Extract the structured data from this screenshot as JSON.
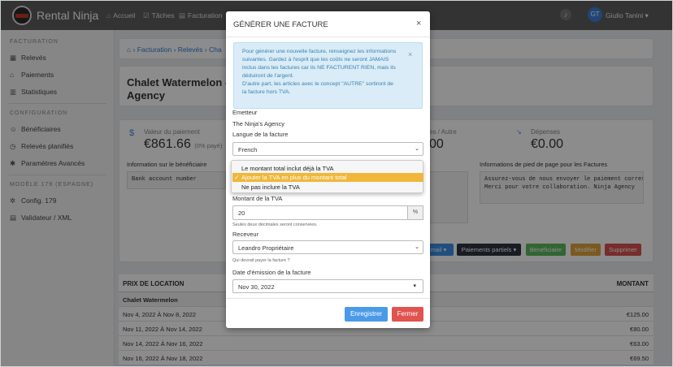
{
  "app": {
    "brand": "Rental Ninja"
  },
  "topnav": {
    "items": [
      {
        "label": "Accueil",
        "icon": "home-icon"
      },
      {
        "label": "Tâches",
        "icon": "checkbox-icon"
      },
      {
        "label": "Facturation",
        "icon": "invoice-icon"
      }
    ],
    "user": {
      "initials": "GT",
      "name": "Giulio Tanini"
    }
  },
  "sidebar": {
    "sections": [
      {
        "title": "FACTURATION",
        "items": [
          {
            "label": "Relevés",
            "icon": "statement-icon"
          },
          {
            "label": "Paiements",
            "icon": "bank-icon"
          },
          {
            "label": "Statistiques",
            "icon": "chart-icon"
          }
        ]
      },
      {
        "title": "CONFIGURATION",
        "items": [
          {
            "label": "Bénéficiaires",
            "icon": "user-circle-icon"
          },
          {
            "label": "Relevés planifiés",
            "icon": "calendar-check-icon"
          },
          {
            "label": "Paramètres Avancés",
            "icon": "gears-icon"
          }
        ]
      },
      {
        "title": "MODÈLE 179 (ESPAGNE)",
        "items": [
          {
            "label": "Config. 179",
            "icon": "cog-icon"
          },
          {
            "label": "Validateur / XML",
            "icon": "document-icon"
          }
        ]
      }
    ]
  },
  "breadcrumb": {
    "items": [
      "Facturation",
      "Relevés",
      "Cha"
    ]
  },
  "page": {
    "title_line1": "Chalet Watermelon - N",
    "title_line2": "Agency"
  },
  "stats": {
    "payment_label": "Valeur du paiement",
    "payment_value": "€861.66",
    "payment_note": "(0% payé)",
    "other_label": "es / Autre",
    "other_value": "00",
    "expenses_label": "Dépenses",
    "expenses_value": "€0.00"
  },
  "beneficiary": {
    "label": "Information sur le bénéficiaire",
    "value": "Bank account number"
  },
  "footer_info": {
    "label": "Informations de pied de page pour les Factures",
    "value": "Assurez-vous de nous envoyer le paiement correspon\nMerci pour votre collaboration. Ninja Agency"
  },
  "actions": {
    "email": "mail",
    "partial": "Paiements partiels",
    "beneficiary": "Bénéficiaire",
    "edit": "Modifier",
    "delete": "Supprimer"
  },
  "table": {
    "col_left": "PRIX DE LOCATION",
    "col_right": "MONTANT",
    "group": "Chalet Watermelon",
    "rows": [
      {
        "period": "Nov 4, 2022 À Nov 8, 2022",
        "amount": "€125.00"
      },
      {
        "period": "Nov 11, 2022 À Nov 14, 2022",
        "amount": "€80.00"
      },
      {
        "period": "Nov 14, 2022 À Nov 16, 2022",
        "amount": "€63.00"
      },
      {
        "period": "Nov 16, 2022 À Nov 18, 2022",
        "amount": "€69.50"
      }
    ]
  },
  "modal": {
    "title": "GÉNÉRER UNE FACTURE",
    "close": "×",
    "alert_lines": [
      "Pour générer une nouvelle facture, renseignez les informations",
      "suivantes. Gardez à l'esprit que les coûts ne seront JAMAIS",
      "inclus dans les factures car ils NE FACTURENT RIEN, mais ils",
      "déduiront de l'argent.",
      "D'autre part, les articles avec le concept \"AUTRE\" sortiront de",
      "la facture hors TVA."
    ],
    "alert_close": "×",
    "issuer_label": "Emetteur",
    "issuer_value": "The Ninja's Agency",
    "language_label": "Langue de la facture",
    "language_value": "French",
    "vat_options": [
      {
        "label": "Le montant total inclut déjà la TVA",
        "selected": false
      },
      {
        "label": "Ajouter la TVA en plus du montant total",
        "selected": true
      },
      {
        "label": "Ne pas inclure la TVA",
        "selected": false
      }
    ],
    "vat_amount_label": "Montant de la TVA",
    "vat_amount_value": "20",
    "vat_unit": "%",
    "vat_help": "Seules deux décimales seront conservées.",
    "receiver_label": "Receveur",
    "receiver_value": "Leandro Propriétaire",
    "receiver_help": "Qui devrait payer la facture ?",
    "date_label": "Date d'émission de la facture",
    "date_value": "Nov 30, 2022",
    "save": "Enregistrer",
    "close_button": "Fermer"
  },
  "colors": {
    "primary": "#3b8ee8",
    "success": "#5cb85c",
    "warning": "#e0a33a",
    "danger": "#d9534f",
    "dark": "#2f3640",
    "alert_bg": "#d9ecf7",
    "selected_option": "#f0b73b"
  }
}
